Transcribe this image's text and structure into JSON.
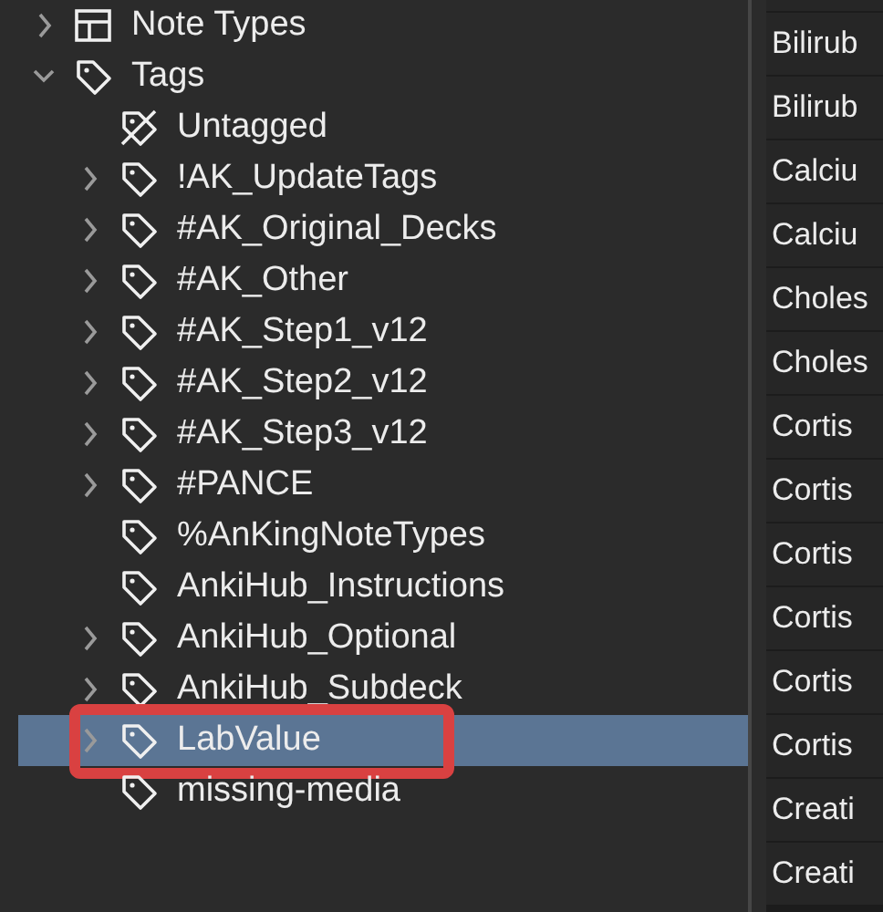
{
  "sidebar": {
    "items": [
      {
        "label": "Note Types",
        "kind": "note-types",
        "expandable": true,
        "expanded": false,
        "selected": false,
        "highlighted": false
      },
      {
        "label": "Tags",
        "kind": "tag",
        "expandable": true,
        "expanded": true,
        "selected": false,
        "highlighted": false,
        "children": [
          {
            "label": "Untagged",
            "kind": "untagged",
            "expandable": false,
            "expanded": false,
            "selected": false,
            "highlighted": false
          },
          {
            "label": "!AK_UpdateTags",
            "kind": "tag",
            "expandable": true,
            "expanded": false,
            "selected": false,
            "highlighted": false
          },
          {
            "label": "#AK_Original_Decks",
            "kind": "tag",
            "expandable": true,
            "expanded": false,
            "selected": false,
            "highlighted": false
          },
          {
            "label": "#AK_Other",
            "kind": "tag",
            "expandable": true,
            "expanded": false,
            "selected": false,
            "highlighted": false
          },
          {
            "label": "#AK_Step1_v12",
            "kind": "tag",
            "expandable": true,
            "expanded": false,
            "selected": false,
            "highlighted": false
          },
          {
            "label": "#AK_Step2_v12",
            "kind": "tag",
            "expandable": true,
            "expanded": false,
            "selected": false,
            "highlighted": false
          },
          {
            "label": "#AK_Step3_v12",
            "kind": "tag",
            "expandable": true,
            "expanded": false,
            "selected": false,
            "highlighted": false
          },
          {
            "label": "#PANCE",
            "kind": "tag",
            "expandable": true,
            "expanded": false,
            "selected": false,
            "highlighted": false
          },
          {
            "label": "%AnKingNoteTypes",
            "kind": "tag",
            "expandable": false,
            "expanded": false,
            "selected": false,
            "highlighted": false
          },
          {
            "label": "AnkiHub_Instructions",
            "kind": "tag",
            "expandable": false,
            "expanded": false,
            "selected": false,
            "highlighted": false
          },
          {
            "label": "AnkiHub_Optional",
            "kind": "tag",
            "expandable": true,
            "expanded": false,
            "selected": false,
            "highlighted": false
          },
          {
            "label": "AnkiHub_Subdeck",
            "kind": "tag",
            "expandable": true,
            "expanded": false,
            "selected": false,
            "highlighted": false
          },
          {
            "label": "LabValue",
            "kind": "tag",
            "expandable": true,
            "expanded": false,
            "selected": true,
            "highlighted": true
          },
          {
            "label": "missing-media",
            "kind": "tag",
            "expandable": false,
            "expanded": false,
            "selected": false,
            "highlighted": false
          }
        ]
      }
    ]
  },
  "table": {
    "rows": [
      "Bilirub",
      "Bilirub",
      "Calciu",
      "Calciu",
      "Choles",
      "Choles",
      "Cortis",
      "Cortis",
      "Cortis",
      "Cortis",
      "Cortis",
      "Cortis",
      "Creati",
      "Creati"
    ]
  }
}
